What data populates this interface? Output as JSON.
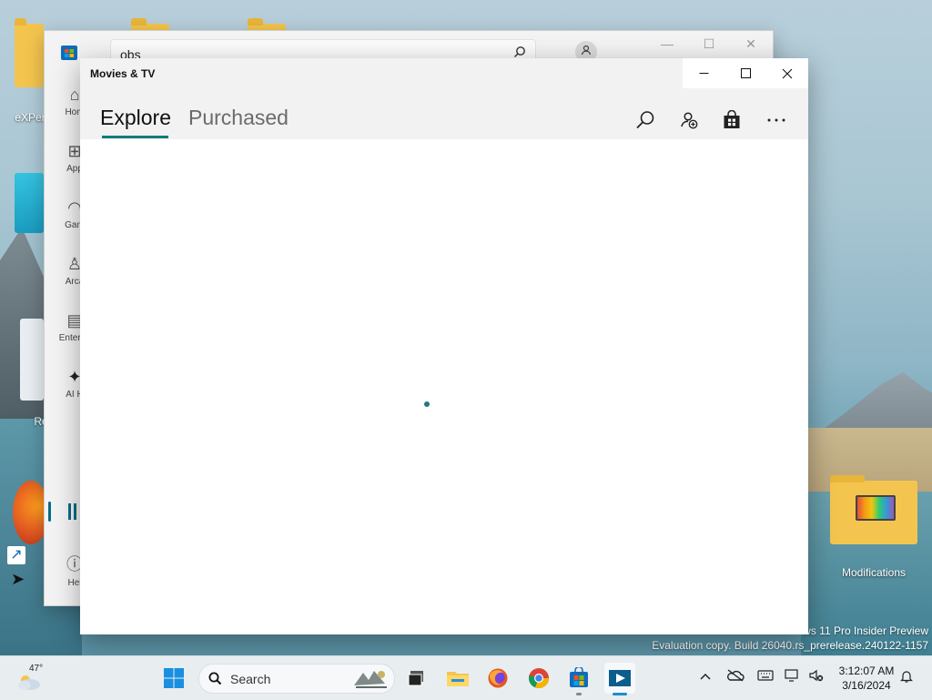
{
  "desktop": {
    "icons": [
      {
        "label": "eXPer"
      },
      {
        "label": "Re"
      },
      {
        "label": "Modifications"
      }
    ],
    "watermark_line1": "ws 11 Pro Insider Preview",
    "watermark_line2": "Evaluation copy. Build 26040.rs_prerelease.240122-1157"
  },
  "store_window": {
    "search_value": "obs",
    "nav_items": [
      {
        "label": "Hom",
        "icon": "home-icon"
      },
      {
        "label": "App",
        "icon": "apps-icon"
      },
      {
        "label": "Gam",
        "icon": "gamepad-icon"
      },
      {
        "label": "Arca",
        "icon": "arcade-icon"
      },
      {
        "label": "Entertai",
        "icon": "clapper-icon"
      },
      {
        "label": "AI H",
        "icon": "sparkle-icon"
      },
      {
        "label": "Hel",
        "icon": "help-icon"
      }
    ]
  },
  "movies_window": {
    "title": "Movies & TV",
    "tabs": [
      {
        "label": "Explore",
        "active": true
      },
      {
        "label": "Purchased",
        "active": false
      }
    ],
    "accent_color": "#107c7c",
    "header_buttons": [
      "search-icon",
      "add-account-icon",
      "store-bag-icon",
      "more-icon"
    ]
  },
  "taskbar": {
    "weather_temp": "47°",
    "search_placeholder": "Search",
    "apps": [
      "start-icon",
      "task-view-icon",
      "file-explorer-icon",
      "firefox-icon",
      "chrome-icon",
      "store-icon",
      "movies-tv-icon"
    ],
    "clock_time": "3:12:07 AM",
    "clock_date": "3/16/2024"
  }
}
